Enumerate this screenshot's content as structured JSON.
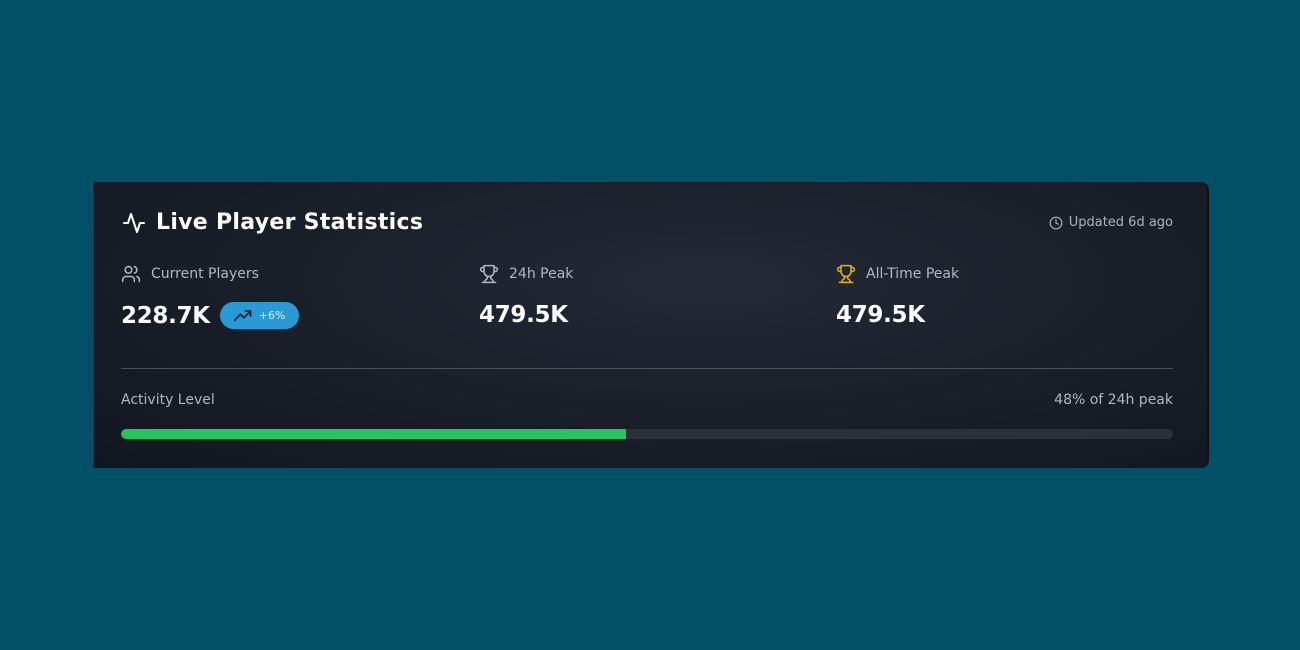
{
  "header": {
    "title": "Live Player Statistics",
    "title_icon": "activity-icon",
    "updated_text": "Updated 6d ago",
    "updated_icon": "clock-icon"
  },
  "stats": [
    {
      "label": "Current Players",
      "icon": "users-icon",
      "value": "228.7K",
      "badge": {
        "text": "+6%",
        "icon": "trending-up-icon"
      }
    },
    {
      "label": "24h Peak",
      "icon": "trophy-icon",
      "value": "479.5K"
    },
    {
      "label": "All-Time Peak",
      "icon": "trophy-gold-icon",
      "value": "479.5K"
    }
  ],
  "activity": {
    "label": "Activity Level",
    "percent_text": "48% of 24h peak",
    "fill_fraction": 0.48
  },
  "colors": {
    "page_background": "#005067",
    "card_background": "#1b202a",
    "badge": "#2a9ad6",
    "progress_fill": "#22c55e",
    "progress_track": "#2b303a",
    "gold_trophy": "#e7b00f",
    "muted_text": "#b2b8c2"
  }
}
